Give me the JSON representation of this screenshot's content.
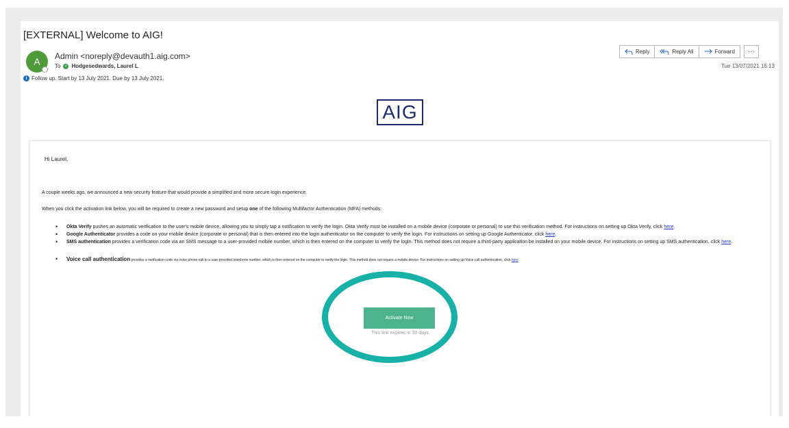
{
  "email": {
    "subject": "[EXTERNAL] Welcome to AIG!",
    "avatar_initial": "A",
    "sender": "Admin <noreply@devauth1.aig.com>",
    "to_label": "To",
    "recipient": "Hodgesedwards, Laurel L",
    "followup": "Follow up.  Start by 13 July 2021.  Due by 13 July 2021.",
    "date": "Tue 13/07/2021 16:13"
  },
  "toolbar": {
    "reply": "Reply",
    "reply_all": "Reply All",
    "forward": "Forward",
    "more": "···"
  },
  "body": {
    "logo": "AIG",
    "greeting": "Hi Laurel,",
    "para1": "A couple weeks ago, we announced a new security feature that would provide a simplified and more secure login experience.",
    "para2_a": "When you click the activation link below, you will be required to create a new password and setup ",
    "para2_b": "one",
    "para2_c": " of the following Multifactor Authentication (MFA) methods:",
    "bullets": [
      {
        "name": "Okta Verify",
        "text": " pushes an automatic verification to the user's mobile device, allowing you to simply tap a notification to verify the login.  Okta Verify must be installed on a mobile device (corporate or personal) to use this verification method.  For instructions on setting up Okta Verify, click ",
        "link": "here",
        "end": "."
      },
      {
        "name": "Google Authenticator",
        "text": " provides a code on your mobile device (corporate or personal) that is then entered into the login authenticator on the computer to verify the login.  For instructions on setting up Google Authenticator, click ",
        "link": "here",
        "end": "."
      },
      {
        "name": "SMS authentication",
        "text": " provides a verification code via an SMS message to a user-provided mobile number, which is then entered on the computer to verify the login.  This method does not require a third-party application be installed on your mobile device.  For instructions on setting up SMS authentication, click ",
        "link": "here",
        "end": "."
      },
      {
        "name": "Voice call authentication",
        "text": " provides a verification code via voice phone call to a user-provided telephone number, which is then entered on the computer to verify the login.  This method does not require a mobile device.  For instructions on setting up Voice call authentication, click ",
        "link": "here",
        "end": ""
      }
    ],
    "cta": "Activate Now",
    "expiry": "This link expires in 30 days."
  },
  "colors": {
    "cta": "#4db38f",
    "highlight_ring": "#18b1a8",
    "avatar": "#4f9b3a",
    "link": "#1a3ad6",
    "logo": "#1c2d6b"
  }
}
